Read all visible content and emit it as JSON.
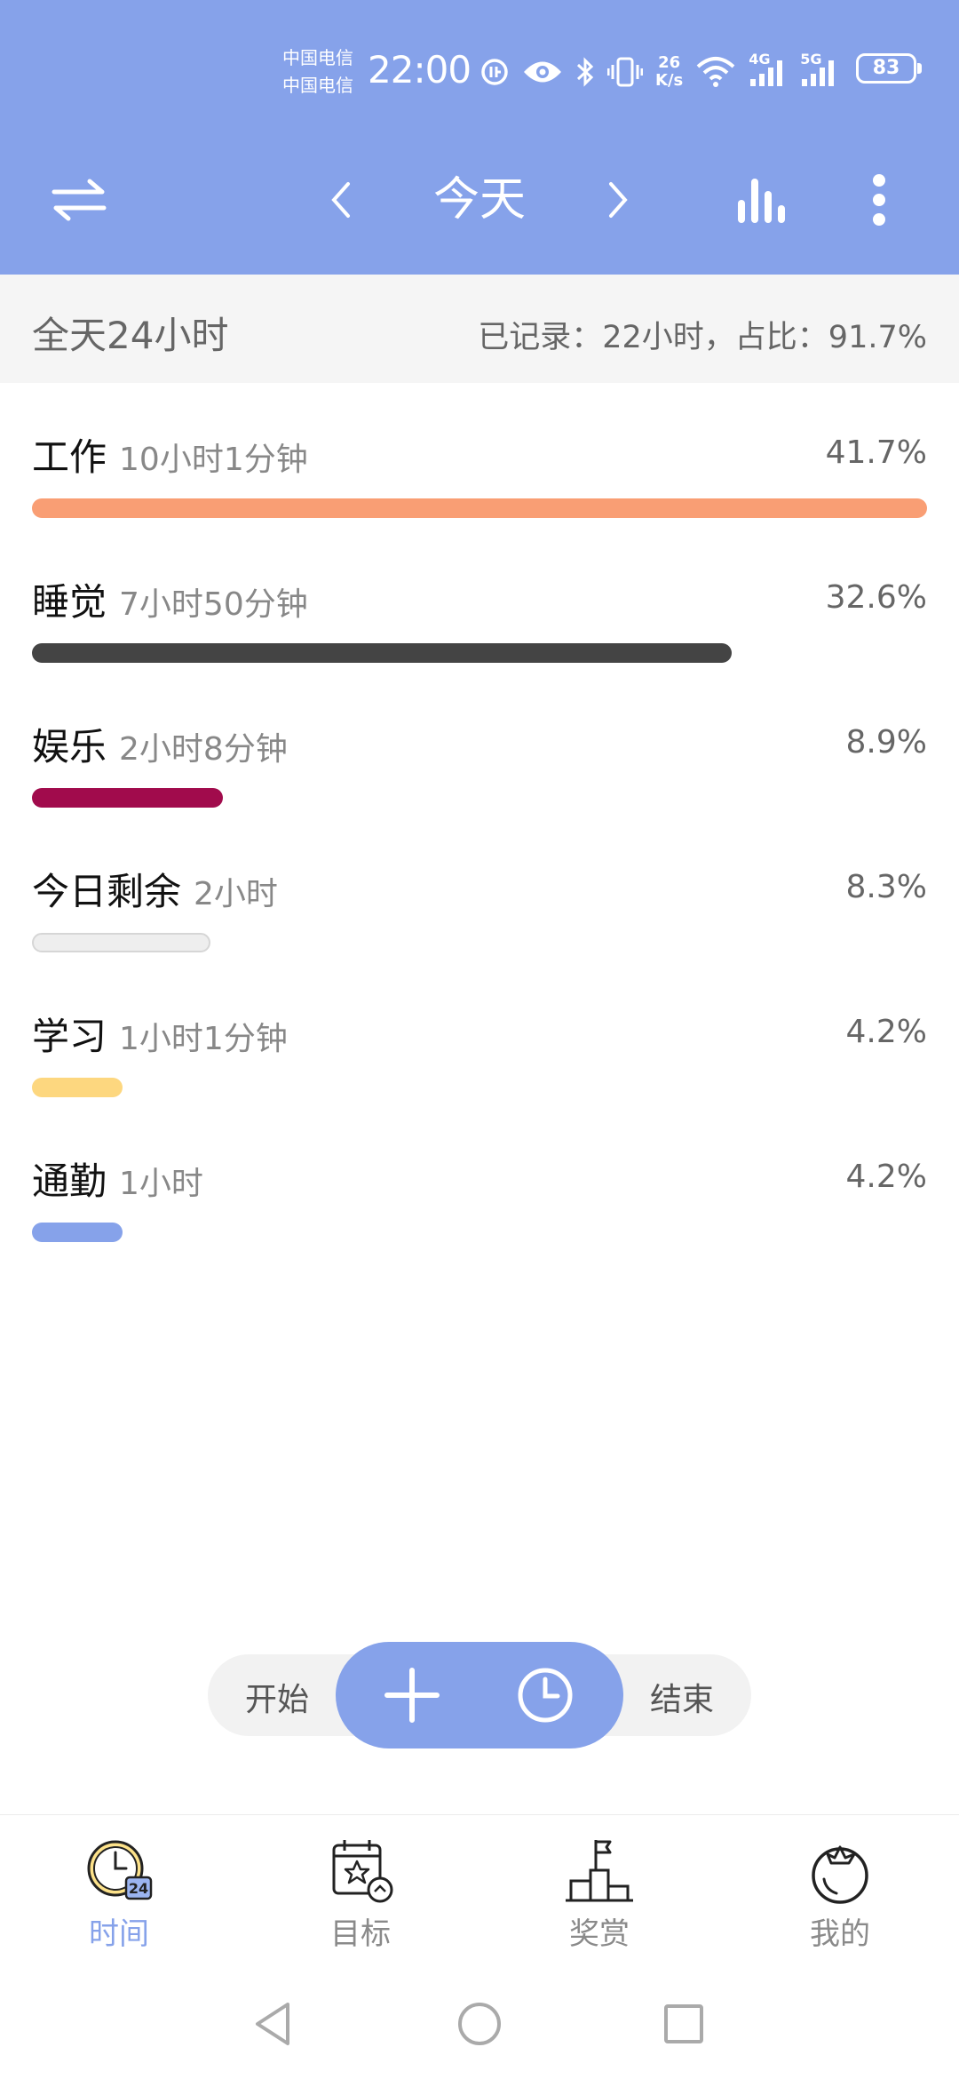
{
  "status": {
    "carrier1": "中国电信",
    "carrier2": "中国电信",
    "time": "22:00",
    "net_speed_value": "26",
    "net_speed_unit": "K/s",
    "sig1_label": "4G",
    "sig2_label": "5G",
    "battery": "83"
  },
  "header": {
    "title": "今天",
    "icons": [
      "swap-icon",
      "chevron-left-icon",
      "chevron-right-icon",
      "bar-chart-icon",
      "more-icon"
    ]
  },
  "summary": {
    "left": "全天24小时",
    "right": "已记录：22小时，占比：91.7%"
  },
  "categories": [
    {
      "name": "工作",
      "duration": "10小时1分钟",
      "percent": "41.7%",
      "share": 1.0,
      "color": "#f99e74"
    },
    {
      "name": "睡觉",
      "duration": "7小时50分钟",
      "percent": "32.6%",
      "share": 0.782,
      "color": "#444444"
    },
    {
      "name": "娱乐",
      "duration": "2小时8分钟",
      "percent": "8.9%",
      "share": 0.213,
      "color": "#a10b4c"
    },
    {
      "name": "今日剩余",
      "duration": "2小时",
      "percent": "8.3%",
      "share": 0.199,
      "color": "#eeeeee"
    },
    {
      "name": "学习",
      "duration": "1小时1分钟",
      "percent": "4.2%",
      "share": 0.101,
      "color": "#fdd77f"
    },
    {
      "name": "通勤",
      "duration": "1小时",
      "percent": "4.2%",
      "share": 0.101,
      "color": "#86a2ea"
    }
  ],
  "action": {
    "start_label": "开始",
    "end_label": "结束"
  },
  "nav": {
    "items": [
      {
        "label": "时间",
        "icon": "clock-24-icon",
        "active": true,
        "badge": "24"
      },
      {
        "label": "目标",
        "icon": "calendar-star-icon",
        "active": false
      },
      {
        "label": "奖赏",
        "icon": "podium-flag-icon",
        "active": false
      },
      {
        "label": "我的",
        "icon": "tomato-icon",
        "active": false
      }
    ]
  },
  "colors": {
    "accent": "#86a2ea",
    "summary_bg": "#f5f5f5"
  }
}
